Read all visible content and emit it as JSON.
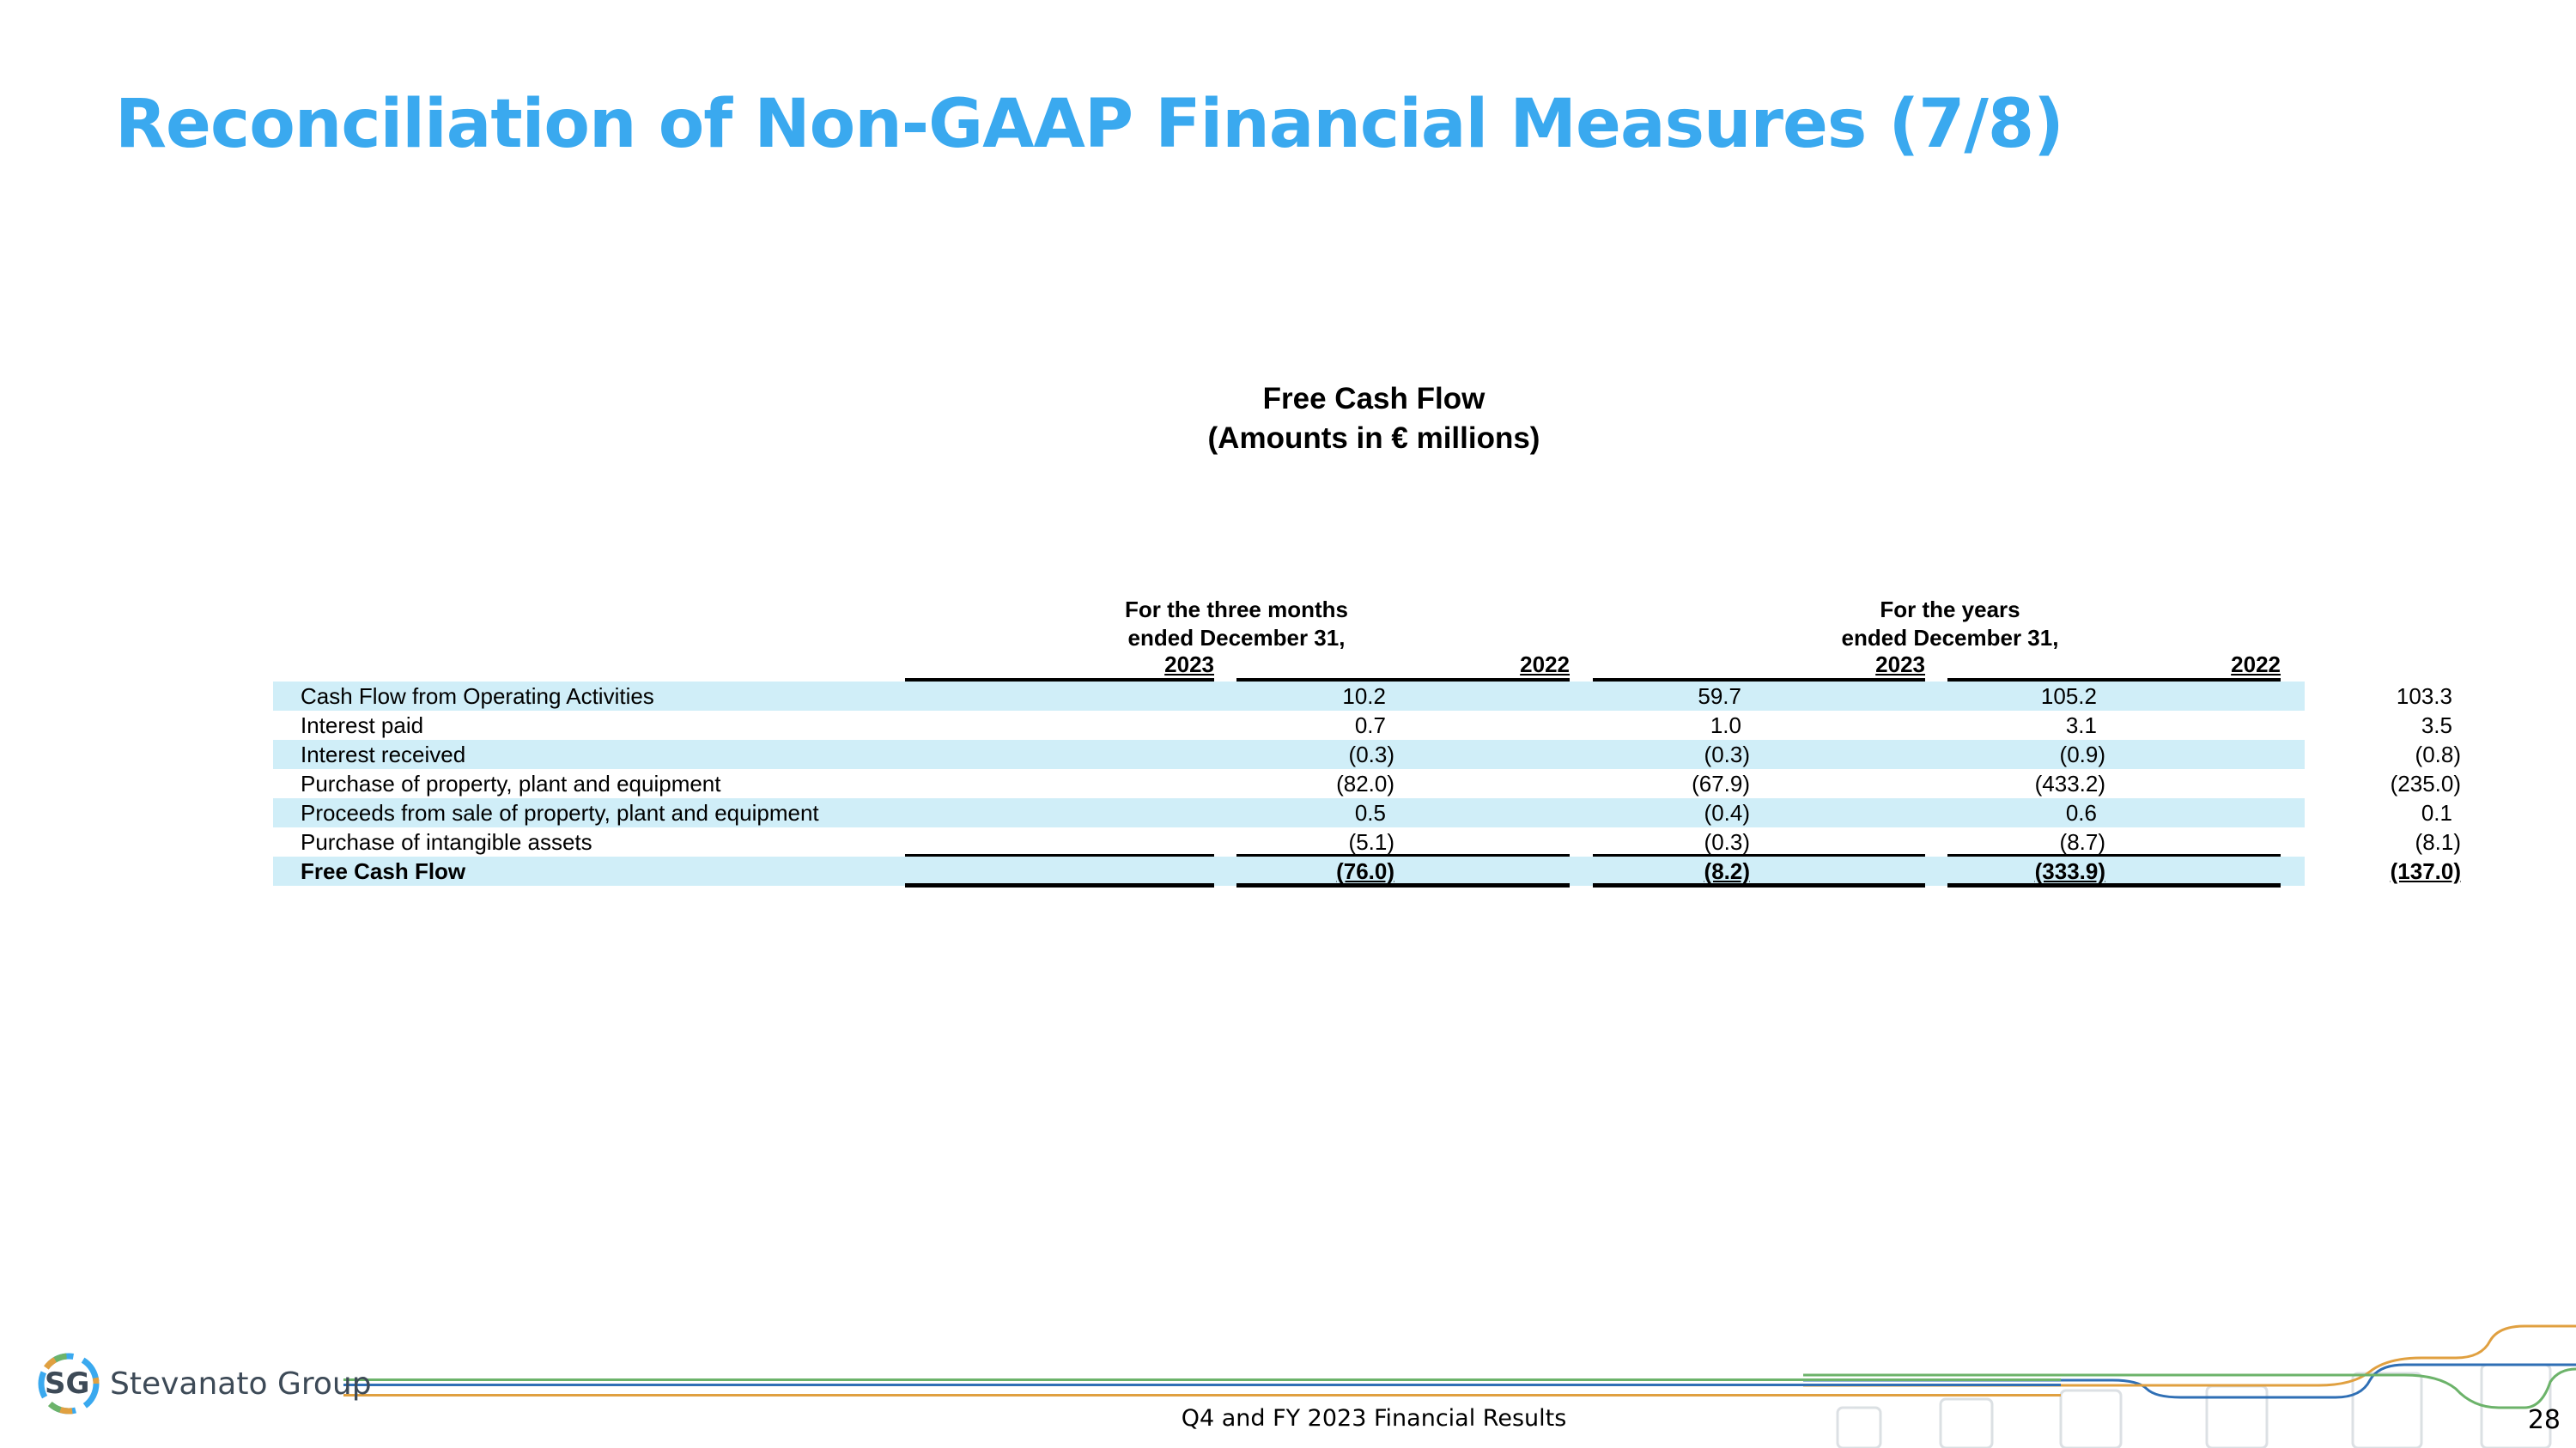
{
  "slide": {
    "title": "Reconciliation of Non-GAAP Financial Measures (7/8)",
    "page_number": "28",
    "footer_caption": "Q4 and FY 2023 Financial Results"
  },
  "logo": {
    "mark": "SG",
    "name": "Stevanato Group"
  },
  "table": {
    "heading": "Free Cash Flow",
    "subheading": "(Amounts in € millions)",
    "period_headers": [
      {
        "line1": "For the three months",
        "line2": "ended December 31,"
      },
      {
        "line1": "For the years",
        "line2": "ended December 31,"
      }
    ],
    "years": [
      "2023",
      "2022",
      "2023",
      "2022"
    ],
    "rows": [
      {
        "label": "Cash Flow from Operating Activities",
        "values": [
          "10.2",
          "59.7",
          "105.2",
          "103.3"
        ]
      },
      {
        "label": "Interest paid",
        "values": [
          "0.7",
          "1.0",
          "3.1",
          "3.5"
        ]
      },
      {
        "label": "Interest received",
        "values": [
          "(0.3)",
          "(0.3)",
          "(0.9)",
          "(0.8)"
        ]
      },
      {
        "label": "Purchase of property, plant and equipment",
        "values": [
          "(82.0)",
          "(67.9)",
          "(433.2)",
          "(235.0)"
        ]
      },
      {
        "label": "Proceeds from sale of property, plant and equipment",
        "values": [
          "0.5",
          "(0.4)",
          "0.6",
          "0.1"
        ]
      },
      {
        "label": "Purchase of intangible assets",
        "values": [
          "(5.1)",
          "(0.3)",
          "(8.7)",
          "(8.1)"
        ]
      },
      {
        "label": "Free Cash Flow",
        "values": [
          "(76.0)",
          "(8.2)",
          "(333.9)",
          "(137.0)"
        ]
      }
    ]
  },
  "colors": {
    "title": "#3aa9ef",
    "row_shade": "#d0eef8",
    "footer_green": "#6cb36a",
    "footer_blue": "#2f6fb5",
    "footer_orange": "#e0a040"
  }
}
